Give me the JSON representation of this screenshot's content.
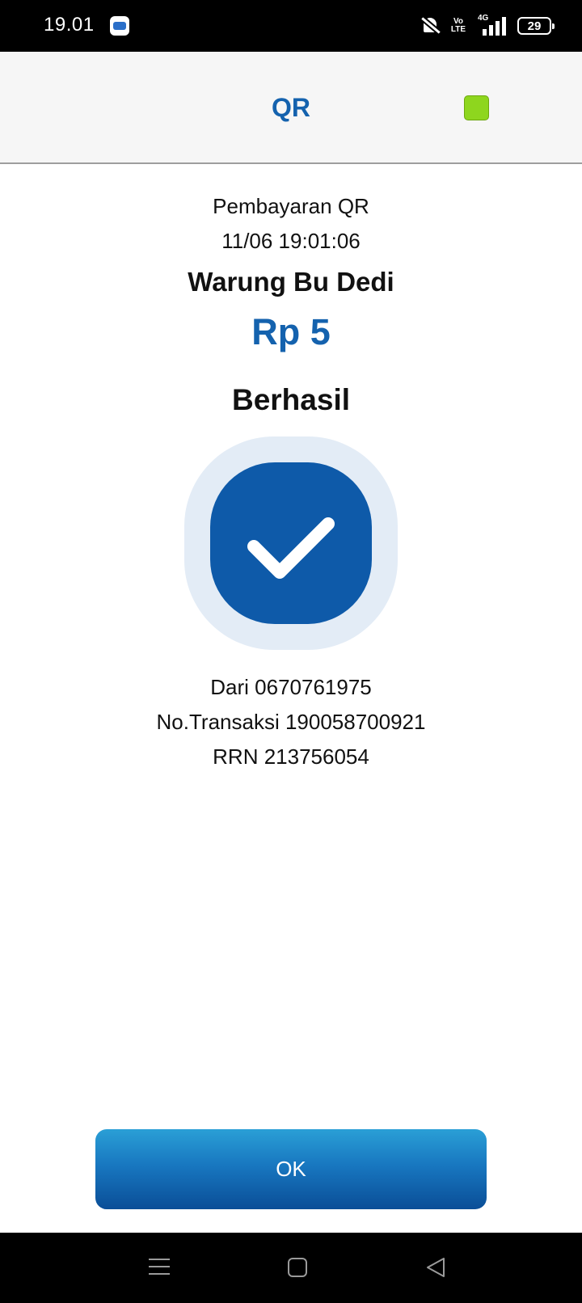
{
  "status_bar": {
    "time": "19.01",
    "network": "4G",
    "volte": "Vo LTE",
    "battery": "29"
  },
  "header": {
    "title": "QR",
    "badge_color": "#8ed61e"
  },
  "transaction": {
    "type": "Pembayaran QR",
    "datetime": "11/06 19:01:06",
    "merchant": "Warung Bu Dedi",
    "amount": "Rp 5",
    "status": "Berhasil",
    "from": "Dari 0670761975",
    "transaction_no": "No.Transaksi 190058700921",
    "rrn": "RRN 213756054"
  },
  "actions": {
    "ok_label": "OK"
  },
  "icons": {
    "success": "checkmark-icon",
    "nav_menu": "menu-icon",
    "nav_home": "home-icon",
    "nav_back": "back-icon"
  },
  "colors": {
    "accent": "#1462ae",
    "success_bg": "#0e5aa9",
    "success_halo": "#e3ecf6"
  }
}
